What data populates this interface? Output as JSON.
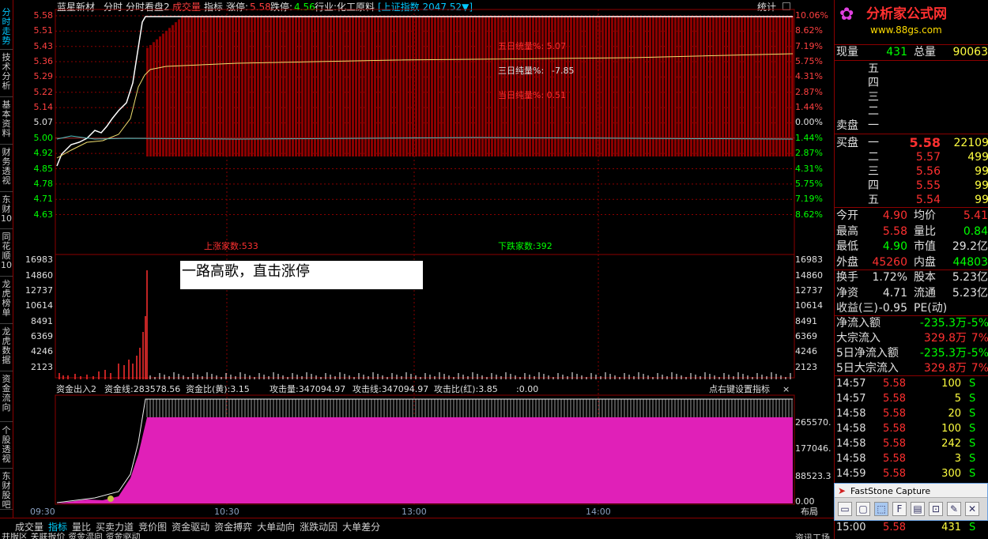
{
  "left_tabs": [
    "分时走势",
    "技术分析",
    "基本资料",
    "财务透视",
    "东财10",
    "同花顺10",
    "龙虎榜单",
    "龙虎数据",
    "资金流向",
    "个股透视",
    "东财股吧"
  ],
  "header": {
    "stock": "蓝星新材",
    "mode1": "分时",
    "mode2": "分时看盘2",
    "item_vol": "成交量",
    "item_ind": "指标",
    "limit_up_label": "涨停:",
    "limit_up": "5.58",
    "limit_down_label": "跌停:",
    "limit_down": "4.56",
    "industry": "行业:化工原料",
    "index": "[上证指数 2047.52▼]",
    "stats": "统计"
  },
  "price_axis": [
    "5.58",
    "5.51",
    "5.43",
    "5.36",
    "5.29",
    "5.22",
    "5.14",
    "5.07",
    "5.00",
    "4.92",
    "4.85",
    "4.78",
    "4.71",
    "4.63"
  ],
  "pct_axis": [
    "10.06%",
    "8.62%",
    "7.19%",
    "5.75%",
    "4.31%",
    "2.87%",
    "1.44%",
    "0.00%",
    "1.44%",
    "2.87%",
    "4.31%",
    "5.75%",
    "7.19%",
    "8.62%"
  ],
  "vol_axis": [
    "16983",
    "14860",
    "12737",
    "10614",
    "8491",
    "6369",
    "4246",
    "2123"
  ],
  "ind_axis": [
    "265570.",
    "177046.",
    "88523.3",
    "0.00"
  ],
  "annot": {
    "five_day": "五日统量%: 5.07",
    "three_day_label": "三日纯量%:",
    "three_day": "-7.85",
    "today": "当日纯量%: 0.51",
    "up_count": "上涨家数:533",
    "down_count": "下跌家数:392",
    "note": "一路高歌，直击涨停"
  },
  "indicator_bar": {
    "name": "资金出入2",
    "line": "资金线:283578.56",
    "ratio": "资金比(黄):3.15",
    "attack_qty": "攻击量:347094.97",
    "attack_line": "攻击线:347094.97",
    "attack_ratio": "攻击比(红):3.85",
    "zero": ":0.00",
    "hint": "点右键设置指标"
  },
  "time_axis": [
    "09:30",
    "10:30",
    "13:00",
    "14:00"
  ],
  "layout_label": "布局",
  "bottom_tabs": [
    "成交量",
    "指标",
    "量比",
    "买卖力道",
    "竞价图",
    "资金驱动",
    "资金搏弈",
    "大单动向",
    "涨跌动因",
    "大单差分"
  ],
  "bottom_tabs2": [
    "并服区",
    "关联报价",
    "资金流向",
    "资金驱动"
  ],
  "logo": {
    "text": "分析家公式网",
    "url": "www.88gs.com"
  },
  "quote": {
    "now_label": "现量",
    "now": "431",
    "total_label": "总量",
    "total": "90063",
    "sell_label": "卖盘",
    "sell_levels": [
      "五",
      "四",
      "三",
      "二",
      "一"
    ],
    "buy_label": "买盘",
    "buy": [
      {
        "lvl": "一",
        "p": "5.58",
        "v": "22109"
      },
      {
        "lvl": "二",
        "p": "5.57",
        "v": "499"
      },
      {
        "lvl": "三",
        "p": "5.56",
        "v": "99"
      },
      {
        "lvl": "四",
        "p": "5.55",
        "v": "99"
      },
      {
        "lvl": "五",
        "p": "5.54",
        "v": "99"
      }
    ],
    "stats": [
      [
        "今开",
        "4.90",
        "均价",
        "5.41"
      ],
      [
        "最高",
        "5.58",
        "量比",
        "0.84"
      ],
      [
        "最低",
        "4.90",
        "市值",
        "29.2亿"
      ],
      [
        "外盘",
        "45260",
        "内盘",
        "44803"
      ],
      [
        "换手",
        "1.72%",
        "股本",
        "5.23亿"
      ],
      [
        "净资",
        "4.71",
        "流通",
        "5.23亿"
      ],
      [
        "收益(三)",
        "-0.95",
        "PE(动)",
        ""
      ]
    ],
    "flows": [
      [
        "净流入额",
        "-235.3万",
        "-5%"
      ],
      [
        "大宗流入",
        "329.8万",
        "7%"
      ],
      [
        "5日净流入额",
        "-235.3万",
        "-5%"
      ],
      [
        "5日大宗流入",
        "329.8万",
        "7%"
      ]
    ],
    "ticks": [
      [
        "14:57",
        "5.58",
        "100",
        "S"
      ],
      [
        "14:57",
        "5.58",
        "5",
        "S"
      ],
      [
        "14:58",
        "5.58",
        "20",
        "S"
      ],
      [
        "14:58",
        "5.58",
        "100",
        "S"
      ],
      [
        "14:58",
        "5.58",
        "242",
        "S"
      ],
      [
        "14:58",
        "5.58",
        "3",
        "S"
      ],
      [
        "14:59",
        "5.58",
        "300",
        "S"
      ],
      [
        "15:00",
        "5.58",
        "431",
        "S"
      ]
    ],
    "side_tab": "资讯工场"
  },
  "capture": {
    "title": "FastStone Capture"
  },
  "colors": {
    "up": "#ff3030",
    "down": "#00ff00",
    "frame": "#8b0000",
    "bar": "#8b0000",
    "magenta": "#e020b8"
  }
}
